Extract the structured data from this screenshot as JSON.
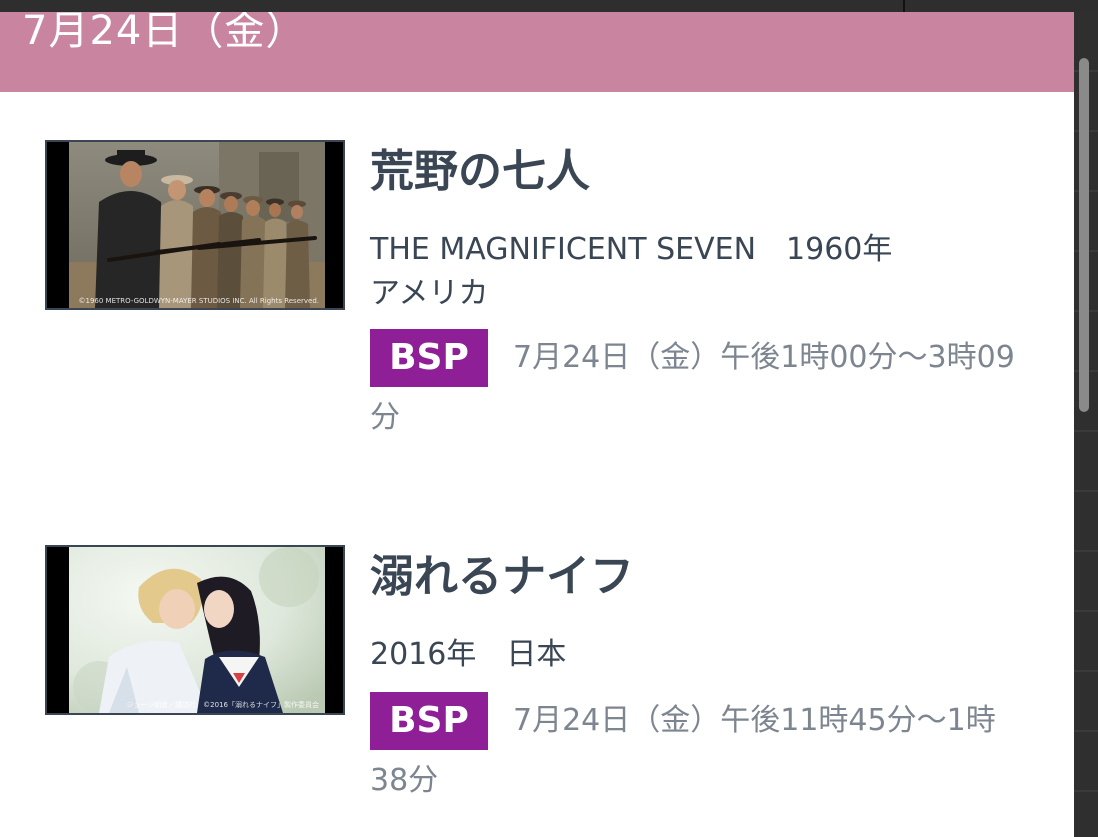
{
  "date_header": "7月24日（金）",
  "programs": [
    {
      "title": "荒野の七人",
      "meta_line1": "THE MAGNIFICENT SEVEN　1960年",
      "meta_line2": "アメリカ",
      "channel": "BSP",
      "airtime": "7月24日（金）午後1時00分～3時09分",
      "thumbnail_copyright": "©1960 METRO-GOLDWYN-MAYER STUDIOS INC. All Rights Reserved."
    },
    {
      "title": "溺れるナイフ",
      "meta_line1": "2016年　日本",
      "channel": "BSP",
      "airtime": "7月24日（金）午後11時45分～1時38分",
      "thumbnail_copyright": "ジョージ朝倉／講談社　©2016「溺れるナイフ」製作委員会"
    }
  ],
  "colors": {
    "header_bg": "#c9849f",
    "badge_bg": "#8e1f97",
    "title_text": "#3a4654",
    "airtime_text": "#7d8690"
  }
}
